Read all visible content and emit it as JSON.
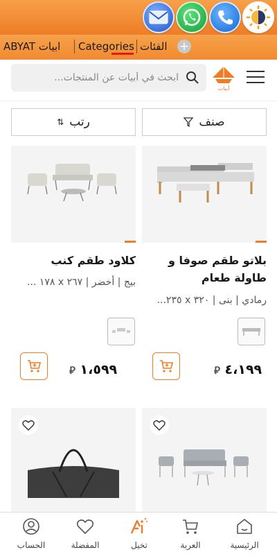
{
  "contact": {
    "mail_icon": "envelope-icon",
    "whatsapp_icon": "whatsapp-icon",
    "phone_icon": "phone-icon",
    "theme_icon": "theme-toggle-icon"
  },
  "langbar": {
    "abyat": "ABYAT ابيات",
    "categories": "Categories",
    "categories_ar": "الفئات",
    "plus_icon": "plus-icon"
  },
  "header": {
    "search_placeholder": "ابحث في أبيات عن المنتجات...",
    "logo_text": "أبيات",
    "brand_color": "#ee7d26"
  },
  "controls": {
    "sort_label": "رتب",
    "filter_label": "صنف"
  },
  "products": [
    {
      "name": "بلاتو طقم صوفا و طاولة طعام",
      "specs": "رمادي | بنى | ٣٢٠ x ٢٣٥...",
      "price": "٤،١٩٩"
    },
    {
      "name": "كلاود طقم كنب",
      "specs": "بيج | أخضر | ٢٦٧ x ١٧٨ ...",
      "price": "١،٥٩٩"
    }
  ],
  "bottom_nav": [
    {
      "label": "الرئيسية",
      "icon": "home-icon"
    },
    {
      "label": "العربة",
      "icon": "cart-icon"
    },
    {
      "label": "تخيل",
      "icon": "ai-imagine-icon"
    },
    {
      "label": "المفضلة",
      "icon": "heart-icon"
    },
    {
      "label": "الحساب",
      "icon": "user-icon"
    }
  ]
}
